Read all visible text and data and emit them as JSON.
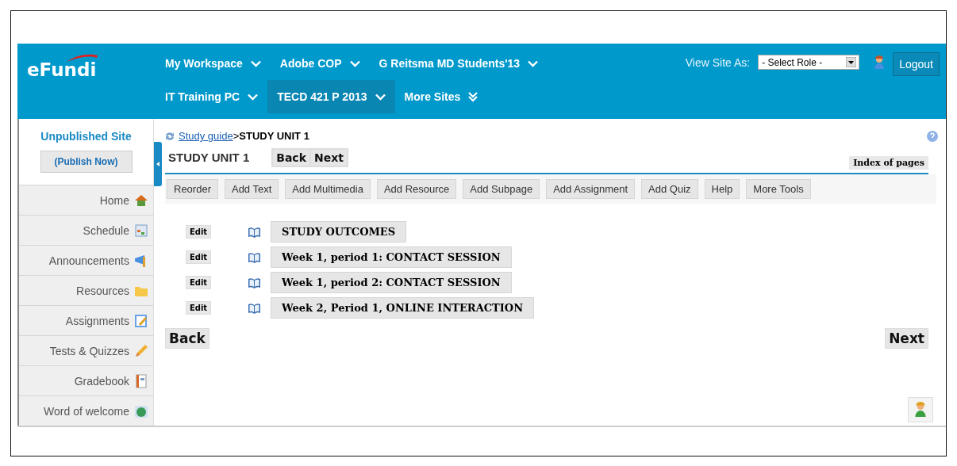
{
  "header": {
    "logo": "eFundi",
    "sites": [
      {
        "label": "My Workspace",
        "selected": false,
        "kind": "menu"
      },
      {
        "label": "Adobe COP",
        "selected": false,
        "kind": "menu"
      },
      {
        "label": "G Reitsma MD Students'13",
        "selected": false,
        "kind": "menu"
      },
      {
        "label": "IT Training PC",
        "selected": false,
        "kind": "menu"
      },
      {
        "label": "TECD 421 P 2013",
        "selected": true,
        "kind": "menu"
      },
      {
        "label": "More Sites",
        "selected": false,
        "kind": "more"
      }
    ],
    "view_site_as": {
      "label": "View Site As:",
      "value": "- Select Role -"
    },
    "logout": "Logout"
  },
  "sidebar": {
    "status": "Unpublished Site",
    "publish": "(Publish Now)",
    "items": [
      {
        "label": "Home"
      },
      {
        "label": "Schedule"
      },
      {
        "label": "Announcements"
      },
      {
        "label": "Resources"
      },
      {
        "label": "Assignments"
      },
      {
        "label": "Tests & Quizzes"
      },
      {
        "label": "Gradebook"
      },
      {
        "label": "Word of welcome"
      }
    ]
  },
  "content": {
    "breadcrumb_link": "Study guide",
    "breadcrumb_sep": ">",
    "breadcrumb_current": "STUDY UNIT 1",
    "title": "STUDY UNIT 1",
    "back": "Back",
    "next": "Next",
    "index": "Index of pages",
    "toolbar": [
      "Reorder",
      "Add Text",
      "Add Multimedia",
      "Add Resource",
      "Add Subpage",
      "Add Assignment",
      "Add Quiz",
      "Help",
      "More Tools"
    ],
    "items": [
      {
        "edit": "Edit",
        "title": "STUDY OUTCOMES"
      },
      {
        "edit": "Edit",
        "title": "Week 1, period 1: CONTACT SESSION"
      },
      {
        "edit": "Edit",
        "title": "Week 1, period 2: CONTACT SESSION"
      },
      {
        "edit": "Edit",
        "title": "Week 2, Period 1, ONLINE INTERACTION"
      }
    ],
    "bottom_back": "Back",
    "bottom_next": "Next"
  }
}
